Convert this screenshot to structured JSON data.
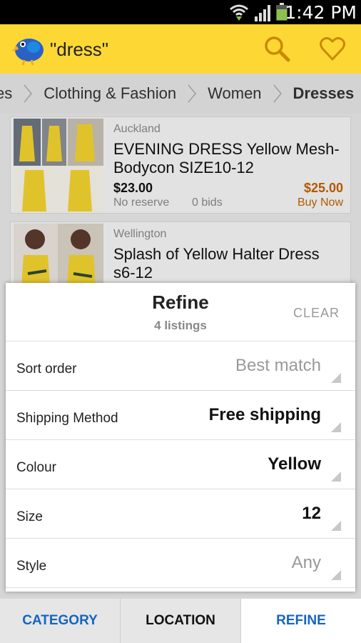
{
  "status_bar": {
    "time": "1:42 PM"
  },
  "app_bar": {
    "query": "\"dress\""
  },
  "breadcrumb": [
    "es",
    "Clothing & Fashion",
    "Women",
    "Dresses"
  ],
  "listings": [
    {
      "location": "Auckland",
      "title": "EVENING DRESS Yellow Mesh-Bodycon SIZE10-12",
      "price": "$23.00",
      "reserve": "No reserve",
      "bids": "0 bids",
      "buy_now_price": "$25.00",
      "buy_now": "Buy Now"
    },
    {
      "location": "Wellington",
      "title": "Splash of Yellow Halter Dress s6-12"
    }
  ],
  "refine": {
    "title": "Refine",
    "count": "4 listings",
    "clear": "CLEAR",
    "rows": [
      {
        "label": "Sort order",
        "value": "Best match"
      },
      {
        "label": "Shipping Method",
        "value": "Free shipping"
      },
      {
        "label": "Colour",
        "value": "Yellow"
      },
      {
        "label": "Size",
        "value": "12"
      },
      {
        "label": "Style",
        "value": "Any"
      }
    ]
  },
  "tabs": [
    "CATEGORY",
    "LOCATION",
    "REFINE"
  ],
  "colors": {
    "app_bar": "#fdd835",
    "accent_blue": "#1565c0",
    "buy_now": "#c06000"
  },
  "icons": [
    "wifi-icon",
    "signal-icon",
    "battery-icon",
    "kiwi-logo-icon",
    "search-icon",
    "heart-icon",
    "chevron-right-icon",
    "dropdown-corner-icon"
  ]
}
